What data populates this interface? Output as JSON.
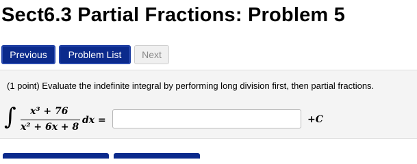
{
  "page": {
    "title": "Sect6.3 Partial Fractions: Problem 5"
  },
  "nav": {
    "previous_label": "Previous",
    "problem_list_label": "Problem List",
    "next_label": "Next"
  },
  "problem": {
    "statement": "(1 point) Evaluate the indefinite integral by performing long division first, then partial fractions.",
    "integral_symbol": "∫",
    "numerator": "x³ + 76",
    "denominator": "x² + 6x + 8",
    "differential": "dx =",
    "answer_value": "",
    "answer_placeholder": "",
    "constant_plus": "+",
    "constant_letter": "C"
  },
  "colors": {
    "primary_button": "#0b2a8c",
    "disabled_button": "#f0f0f0",
    "problem_background": "#f4f4f4"
  }
}
